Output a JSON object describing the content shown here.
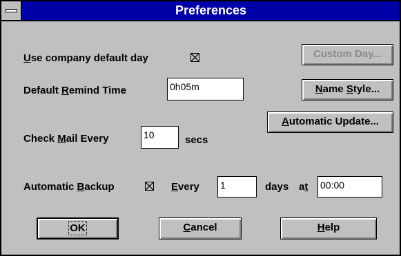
{
  "window": {
    "title": "Preferences"
  },
  "company_default_day": {
    "label": "Use company default day",
    "mnemonic": "U",
    "checked": true
  },
  "custom_day_button": {
    "label": "Custom Day...",
    "enabled": false
  },
  "remind_time": {
    "label": "Default Remind Time",
    "mnemonic": "R",
    "value": "0h05m"
  },
  "name_style_button": {
    "label": "Name Style..."
  },
  "automatic_update_button": {
    "label": "Automatic Update..."
  },
  "check_mail": {
    "label": "Check Mail Every",
    "mnemonic": "M",
    "value": "10",
    "unit": "secs"
  },
  "backup": {
    "label": "Automatic Backup",
    "mnemonic": "B",
    "checked": true,
    "every_label": "Every",
    "every_value": "1",
    "days_label": "days",
    "at_label": "at",
    "time_value": "00:00"
  },
  "buttons": {
    "ok": "OK",
    "cancel": "Cancel",
    "help": "Help"
  },
  "colors": {
    "face": "#c0c0c0",
    "titlebar": "#0000a8",
    "title_text": "#ffffff"
  }
}
